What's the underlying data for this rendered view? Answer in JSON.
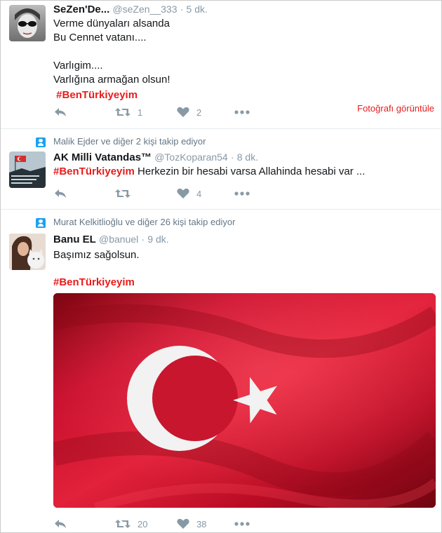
{
  "tweets": [
    {
      "name": "SeZen'De...",
      "handle": "@seZen__333",
      "time": "5 dk.",
      "text": "Verme dünyaları alsanda\nBu Cennet vatanı....\n\nVarlıgim....\nVarlığına armağan olsun!",
      "hashtag": "#BenTürkiyeyim",
      "retweets": "1",
      "likes": "2",
      "photo_link": "Fotoğrafı görüntüle"
    },
    {
      "context": "Malik Ejder ve diğer 2 kişi takip ediyor",
      "name": "AK Milli Vatandas™",
      "handle": "@TozKoparan54",
      "time": "8 dk.",
      "hashtag": "#BenTürkiyeyim",
      "text": " Herkezin bir hesabi varsa Allahinda hesabi var ...",
      "retweets": "",
      "likes": "4"
    },
    {
      "context": "Murat Kelkitlioğlu ve diğer 26 kişi takip ediyor",
      "name": "Banu EL",
      "handle": "@banuel",
      "time": "9 dk.",
      "text": "Başımız sağolsun.",
      "hashtag": "#BenTürkiyeyim",
      "retweets": "20",
      "likes": "38"
    }
  ],
  "icons": {
    "reply": "reply-icon",
    "retweet": "retweet-icon",
    "like": "heart-icon",
    "more": "more-icon",
    "context": "follow-context-icon"
  },
  "colors": {
    "hashtag": "#e81c1c",
    "muted": "#8899a6",
    "flag_red": "#c8102e",
    "flag_white": "#ffffff"
  }
}
